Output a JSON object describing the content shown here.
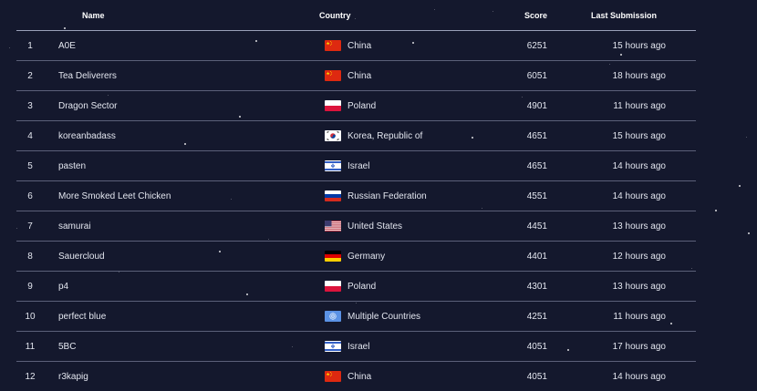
{
  "headers": {
    "name": "Name",
    "country": "Country",
    "score": "Score",
    "last": "Last Submission"
  },
  "rows": [
    {
      "rank": "1",
      "name": "A0E",
      "country": "China",
      "flag": "cn",
      "score": "6251",
      "last": "15 hours ago"
    },
    {
      "rank": "2",
      "name": "Tea Deliverers",
      "country": "China",
      "flag": "cn",
      "score": "6051",
      "last": "18 hours ago"
    },
    {
      "rank": "3",
      "name": "Dragon Sector",
      "country": "Poland",
      "flag": "pl",
      "score": "4901",
      "last": "11 hours ago"
    },
    {
      "rank": "4",
      "name": "koreanbadass",
      "country": "Korea, Republic of",
      "flag": "kr",
      "score": "4651",
      "last": "15 hours ago"
    },
    {
      "rank": "5",
      "name": "pasten",
      "country": "Israel",
      "flag": "il",
      "score": "4651",
      "last": "14 hours ago"
    },
    {
      "rank": "6",
      "name": "More Smoked Leet Chicken",
      "country": "Russian Federation",
      "flag": "ru",
      "score": "4551",
      "last": "14 hours ago"
    },
    {
      "rank": "7",
      "name": "samurai",
      "country": "United States",
      "flag": "us",
      "score": "4451",
      "last": "13 hours ago"
    },
    {
      "rank": "8",
      "name": "Sauercloud",
      "country": "Germany",
      "flag": "de",
      "score": "4401",
      "last": "12 hours ago"
    },
    {
      "rank": "9",
      "name": "p4",
      "country": "Poland",
      "flag": "pl",
      "score": "4301",
      "last": "13 hours ago"
    },
    {
      "rank": "10",
      "name": "perfect blue",
      "country": "Multiple Countries",
      "flag": "un",
      "score": "4251",
      "last": "11 hours ago"
    },
    {
      "rank": "11",
      "name": "5BC",
      "country": "Israel",
      "flag": "il",
      "score": "4051",
      "last": "17 hours ago"
    },
    {
      "rank": "12",
      "name": "r3kapig",
      "country": "China",
      "flag": "cn",
      "score": "4051",
      "last": "14 hours ago"
    }
  ],
  "colors": {
    "background": "#14182d",
    "text": "#e3e6ef",
    "divider": "#5b6079"
  }
}
